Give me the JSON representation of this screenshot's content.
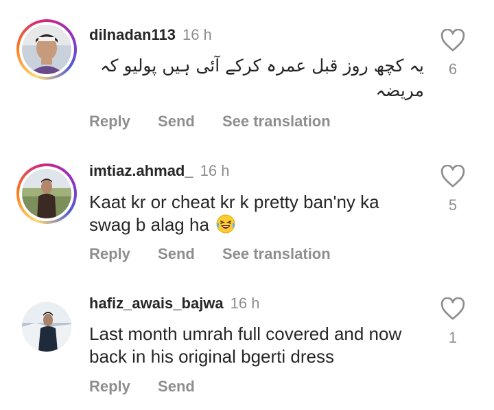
{
  "comments": [
    {
      "username": "dilnadan113",
      "time": "16 h",
      "text": "یہ کچھ روز قبل عمرہ کرکے آئی ہیں پولیو کہ مریضہ",
      "actions": [
        "Reply",
        "Send",
        "See translation"
      ],
      "likes": "6"
    },
    {
      "username": "imtiaz.ahmad_",
      "time": "16 h",
      "text": "Kaat kr or cheat kr k pretty ban'ny ka swag b alag ha",
      "emoji": "face-with-tears-of-joy",
      "actions": [
        "Reply",
        "Send",
        "See translation"
      ],
      "likes": "5"
    },
    {
      "username": "hafiz_awais_bajwa",
      "time": "16 h",
      "text": "Last month umrah full covered and now back in his original bgerti dress",
      "actions": [
        "Reply",
        "Send"
      ],
      "likes": "1"
    }
  ],
  "icons": {
    "like": "heart-outline-icon",
    "story_ring": "instagram-gradient-ring"
  },
  "colors": {
    "text": "#262626",
    "muted": "#8e8e8e",
    "background": "#ffffff"
  }
}
